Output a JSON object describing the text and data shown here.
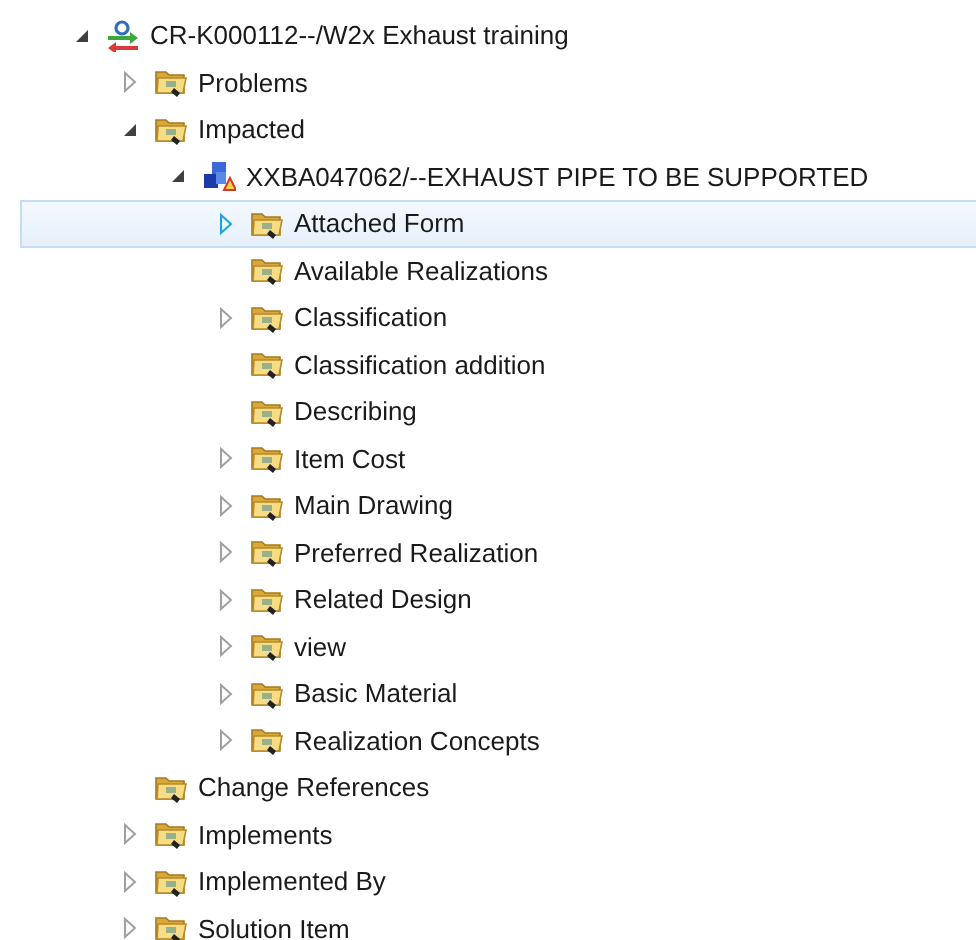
{
  "tree": [
    {
      "label": "CR-K000112--/W2x Exhaust training",
      "kind": "change",
      "expanded": true,
      "selected": false,
      "children": [
        {
          "label": "Problems",
          "kind": "folder",
          "expanded": false,
          "selected": false
        },
        {
          "label": "Impacted",
          "kind": "folder",
          "expanded": true,
          "selected": false,
          "children": [
            {
              "label": "XXBA047062/--EXHAUST PIPE TO BE SUPPORTED",
              "kind": "part",
              "expanded": true,
              "selected": false,
              "children": [
                {
                  "label": "Attached Form",
                  "kind": "folder",
                  "expanded": false,
                  "selected": true
                },
                {
                  "label": "Available Realizations",
                  "kind": "folder",
                  "selected": false
                },
                {
                  "label": "Classification",
                  "kind": "folder",
                  "expanded": false,
                  "selected": false
                },
                {
                  "label": "Classification addition",
                  "kind": "folder",
                  "selected": false
                },
                {
                  "label": "Describing",
                  "kind": "folder",
                  "selected": false
                },
                {
                  "label": "Item Cost",
                  "kind": "folder",
                  "expanded": false,
                  "selected": false
                },
                {
                  "label": "Main Drawing",
                  "kind": "folder",
                  "expanded": false,
                  "selected": false
                },
                {
                  "label": "Preferred Realization",
                  "kind": "folder",
                  "expanded": false,
                  "selected": false
                },
                {
                  "label": "Related Design",
                  "kind": "folder",
                  "expanded": false,
                  "selected": false
                },
                {
                  "label": "view",
                  "kind": "folder",
                  "expanded": false,
                  "selected": false
                },
                {
                  "label": "Basic Material",
                  "kind": "folder",
                  "expanded": false,
                  "selected": false
                },
                {
                  "label": "Realization Concepts",
                  "kind": "folder",
                  "expanded": false,
                  "selected": false
                }
              ]
            }
          ]
        },
        {
          "label": "Change References",
          "kind": "folder",
          "selected": false
        },
        {
          "label": "Implements",
          "kind": "folder",
          "expanded": false,
          "selected": false
        },
        {
          "label": "Implemented By",
          "kind": "folder",
          "expanded": false,
          "selected": false
        },
        {
          "label": "Solution Item",
          "kind": "folder",
          "expanded": false,
          "selected": false
        }
      ]
    }
  ]
}
